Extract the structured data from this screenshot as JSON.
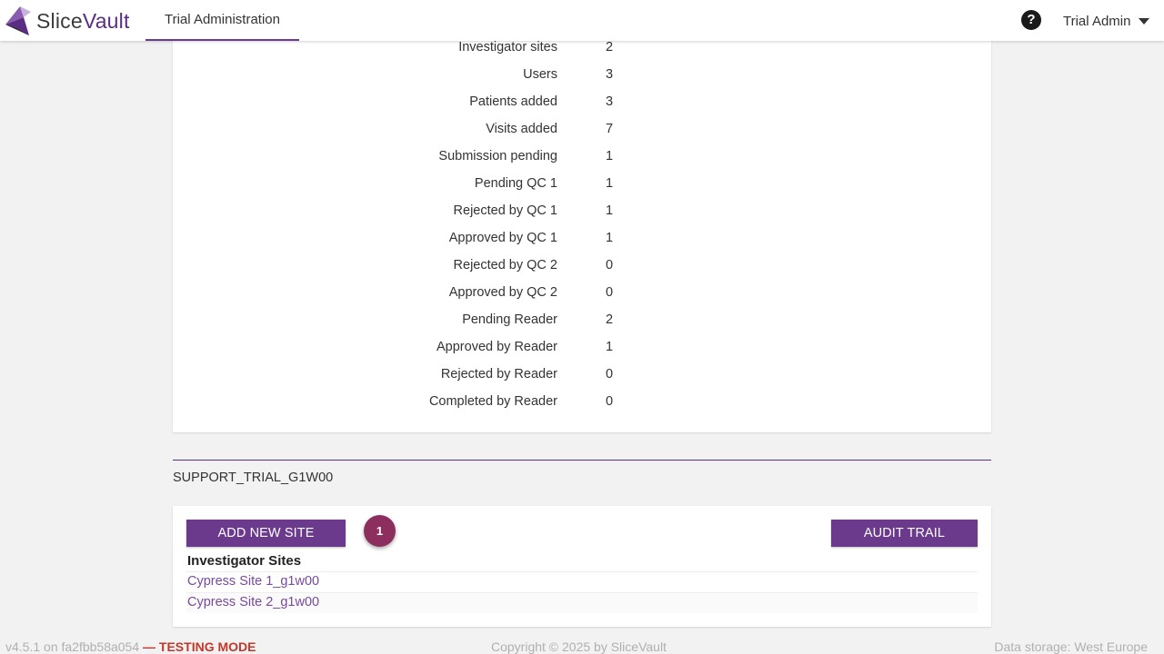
{
  "header": {
    "logo_text_slice": "Slice",
    "logo_text_vault": "Vault",
    "nav_tab": "Trial Administration",
    "help_icon": "?",
    "user_name": "Trial Admin"
  },
  "stats": [
    {
      "label": "Investigator sites",
      "value": "2"
    },
    {
      "label": "Users",
      "value": "3"
    },
    {
      "label": "Patients added",
      "value": "3"
    },
    {
      "label": "Visits added",
      "value": "7"
    },
    {
      "label": "Submission pending",
      "value": "1"
    },
    {
      "label": "Pending QC 1",
      "value": "1"
    },
    {
      "label": "Rejected by QC 1",
      "value": "1"
    },
    {
      "label": "Approved by QC 1",
      "value": "1"
    },
    {
      "label": "Rejected by QC 2",
      "value": "0"
    },
    {
      "label": "Approved by QC 2",
      "value": "0"
    },
    {
      "label": "Pending Reader",
      "value": "2"
    },
    {
      "label": "Approved by Reader",
      "value": "1"
    },
    {
      "label": "Rejected by Reader",
      "value": "0"
    },
    {
      "label": "Completed by Reader",
      "value": "0"
    }
  ],
  "trial": {
    "code": "SUPPORT_TRIAL_G1W00"
  },
  "sites_panel": {
    "add_button": "ADD NEW SITE",
    "audit_button": "AUDIT TRAIL",
    "badge_count": "1",
    "heading": "Investigator Sites",
    "sites": [
      "Cypress Site 1_g1w00",
      "Cypress Site 2_g1w00"
    ]
  },
  "footer": {
    "version": "v4.5.1 on fa2fbb58a054",
    "mode": "— TESTING MODE",
    "copyright": "Copyright © 2025 by SliceVault",
    "storage": "Data storage: West Europe"
  },
  "colors": {
    "brand": "#6b3a8c",
    "badge": "#8c2f5e",
    "link": "#7a4a9c",
    "testing_mode": "#c0392b"
  }
}
